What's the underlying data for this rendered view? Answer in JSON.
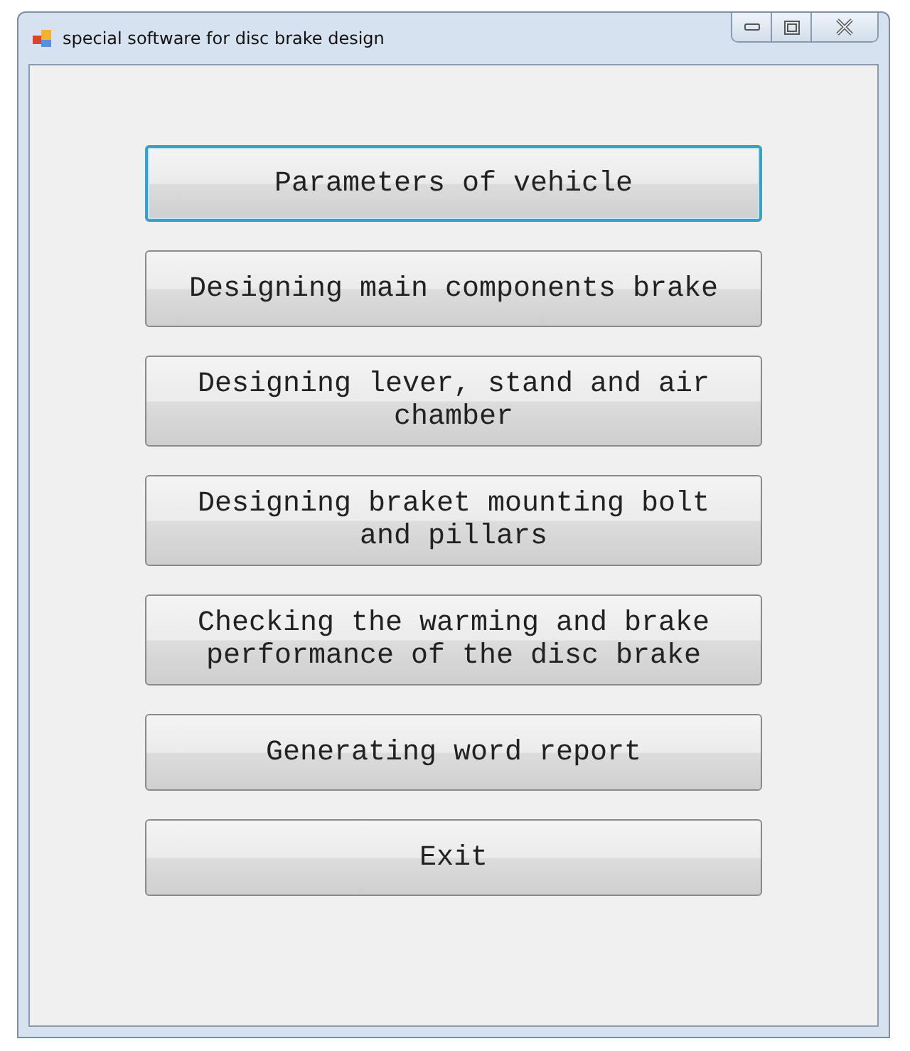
{
  "window": {
    "title": "special software for disc brake design"
  },
  "buttons": [
    {
      "label": "Parameters of vehicle",
      "focused": true
    },
    {
      "label": "Designing main components brake",
      "focused": false
    },
    {
      "label": "Designing lever, stand and air chamber",
      "focused": false
    },
    {
      "label": "Designing braket mounting bolt and pillars",
      "focused": false
    },
    {
      "label": "Checking the warming and brake performance of the disc brake",
      "focused": false
    },
    {
      "label": "Generating word report",
      "focused": false
    },
    {
      "label": "Exit",
      "focused": false
    }
  ]
}
